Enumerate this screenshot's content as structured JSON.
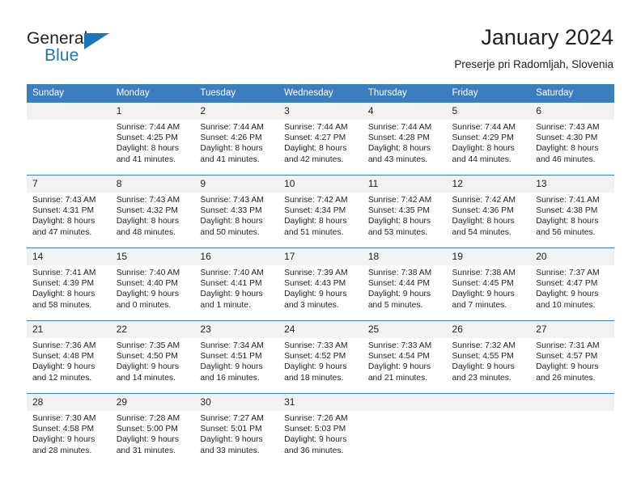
{
  "logo": {
    "word_one": "General",
    "word_two": "Blue",
    "accent_color": "#1b75bb"
  },
  "header": {
    "title": "January 2024",
    "subtitle": "Preserje pri Radomljah, Slovenia"
  },
  "calendar": {
    "header_bg": "#3a7ebf",
    "daynum_bg": "#f2f2f2",
    "weekdays": [
      "Sunday",
      "Monday",
      "Tuesday",
      "Wednesday",
      "Thursday",
      "Friday",
      "Saturday"
    ],
    "weeks": [
      [
        {
          "day": "",
          "lines": []
        },
        {
          "day": "1",
          "lines": [
            "Sunrise: 7:44 AM",
            "Sunset: 4:25 PM",
            "Daylight: 8 hours",
            "and 41 minutes."
          ]
        },
        {
          "day": "2",
          "lines": [
            "Sunrise: 7:44 AM",
            "Sunset: 4:26 PM",
            "Daylight: 8 hours",
            "and 41 minutes."
          ]
        },
        {
          "day": "3",
          "lines": [
            "Sunrise: 7:44 AM",
            "Sunset: 4:27 PM",
            "Daylight: 8 hours",
            "and 42 minutes."
          ]
        },
        {
          "day": "4",
          "lines": [
            "Sunrise: 7:44 AM",
            "Sunset: 4:28 PM",
            "Daylight: 8 hours",
            "and 43 minutes."
          ]
        },
        {
          "day": "5",
          "lines": [
            "Sunrise: 7:44 AM",
            "Sunset: 4:29 PM",
            "Daylight: 8 hours",
            "and 44 minutes."
          ]
        },
        {
          "day": "6",
          "lines": [
            "Sunrise: 7:43 AM",
            "Sunset: 4:30 PM",
            "Daylight: 8 hours",
            "and 46 minutes."
          ]
        }
      ],
      [
        {
          "day": "7",
          "lines": [
            "Sunrise: 7:43 AM",
            "Sunset: 4:31 PM",
            "Daylight: 8 hours",
            "and 47 minutes."
          ]
        },
        {
          "day": "8",
          "lines": [
            "Sunrise: 7:43 AM",
            "Sunset: 4:32 PM",
            "Daylight: 8 hours",
            "and 48 minutes."
          ]
        },
        {
          "day": "9",
          "lines": [
            "Sunrise: 7:43 AM",
            "Sunset: 4:33 PM",
            "Daylight: 8 hours",
            "and 50 minutes."
          ]
        },
        {
          "day": "10",
          "lines": [
            "Sunrise: 7:42 AM",
            "Sunset: 4:34 PM",
            "Daylight: 8 hours",
            "and 51 minutes."
          ]
        },
        {
          "day": "11",
          "lines": [
            "Sunrise: 7:42 AM",
            "Sunset: 4:35 PM",
            "Daylight: 8 hours",
            "and 53 minutes."
          ]
        },
        {
          "day": "12",
          "lines": [
            "Sunrise: 7:42 AM",
            "Sunset: 4:36 PM",
            "Daylight: 8 hours",
            "and 54 minutes."
          ]
        },
        {
          "day": "13",
          "lines": [
            "Sunrise: 7:41 AM",
            "Sunset: 4:38 PM",
            "Daylight: 8 hours",
            "and 56 minutes."
          ]
        }
      ],
      [
        {
          "day": "14",
          "lines": [
            "Sunrise: 7:41 AM",
            "Sunset: 4:39 PM",
            "Daylight: 8 hours",
            "and 58 minutes."
          ]
        },
        {
          "day": "15",
          "lines": [
            "Sunrise: 7:40 AM",
            "Sunset: 4:40 PM",
            "Daylight: 9 hours",
            "and 0 minutes."
          ]
        },
        {
          "day": "16",
          "lines": [
            "Sunrise: 7:40 AM",
            "Sunset: 4:41 PM",
            "Daylight: 9 hours",
            "and 1 minute."
          ]
        },
        {
          "day": "17",
          "lines": [
            "Sunrise: 7:39 AM",
            "Sunset: 4:43 PM",
            "Daylight: 9 hours",
            "and 3 minutes."
          ]
        },
        {
          "day": "18",
          "lines": [
            "Sunrise: 7:38 AM",
            "Sunset: 4:44 PM",
            "Daylight: 9 hours",
            "and 5 minutes."
          ]
        },
        {
          "day": "19",
          "lines": [
            "Sunrise: 7:38 AM",
            "Sunset: 4:45 PM",
            "Daylight: 9 hours",
            "and 7 minutes."
          ]
        },
        {
          "day": "20",
          "lines": [
            "Sunrise: 7:37 AM",
            "Sunset: 4:47 PM",
            "Daylight: 9 hours",
            "and 10 minutes."
          ]
        }
      ],
      [
        {
          "day": "21",
          "lines": [
            "Sunrise: 7:36 AM",
            "Sunset: 4:48 PM",
            "Daylight: 9 hours",
            "and 12 minutes."
          ]
        },
        {
          "day": "22",
          "lines": [
            "Sunrise: 7:35 AM",
            "Sunset: 4:50 PM",
            "Daylight: 9 hours",
            "and 14 minutes."
          ]
        },
        {
          "day": "23",
          "lines": [
            "Sunrise: 7:34 AM",
            "Sunset: 4:51 PM",
            "Daylight: 9 hours",
            "and 16 minutes."
          ]
        },
        {
          "day": "24",
          "lines": [
            "Sunrise: 7:33 AM",
            "Sunset: 4:52 PM",
            "Daylight: 9 hours",
            "and 18 minutes."
          ]
        },
        {
          "day": "25",
          "lines": [
            "Sunrise: 7:33 AM",
            "Sunset: 4:54 PM",
            "Daylight: 9 hours",
            "and 21 minutes."
          ]
        },
        {
          "day": "26",
          "lines": [
            "Sunrise: 7:32 AM",
            "Sunset: 4:55 PM",
            "Daylight: 9 hours",
            "and 23 minutes."
          ]
        },
        {
          "day": "27",
          "lines": [
            "Sunrise: 7:31 AM",
            "Sunset: 4:57 PM",
            "Daylight: 9 hours",
            "and 26 minutes."
          ]
        }
      ],
      [
        {
          "day": "28",
          "lines": [
            "Sunrise: 7:30 AM",
            "Sunset: 4:58 PM",
            "Daylight: 9 hours",
            "and 28 minutes."
          ]
        },
        {
          "day": "29",
          "lines": [
            "Sunrise: 7:28 AM",
            "Sunset: 5:00 PM",
            "Daylight: 9 hours",
            "and 31 minutes."
          ]
        },
        {
          "day": "30",
          "lines": [
            "Sunrise: 7:27 AM",
            "Sunset: 5:01 PM",
            "Daylight: 9 hours",
            "and 33 minutes."
          ]
        },
        {
          "day": "31",
          "lines": [
            "Sunrise: 7:26 AM",
            "Sunset: 5:03 PM",
            "Daylight: 9 hours",
            "and 36 minutes."
          ]
        },
        {
          "day": "",
          "lines": []
        },
        {
          "day": "",
          "lines": []
        },
        {
          "day": "",
          "lines": []
        }
      ]
    ]
  }
}
